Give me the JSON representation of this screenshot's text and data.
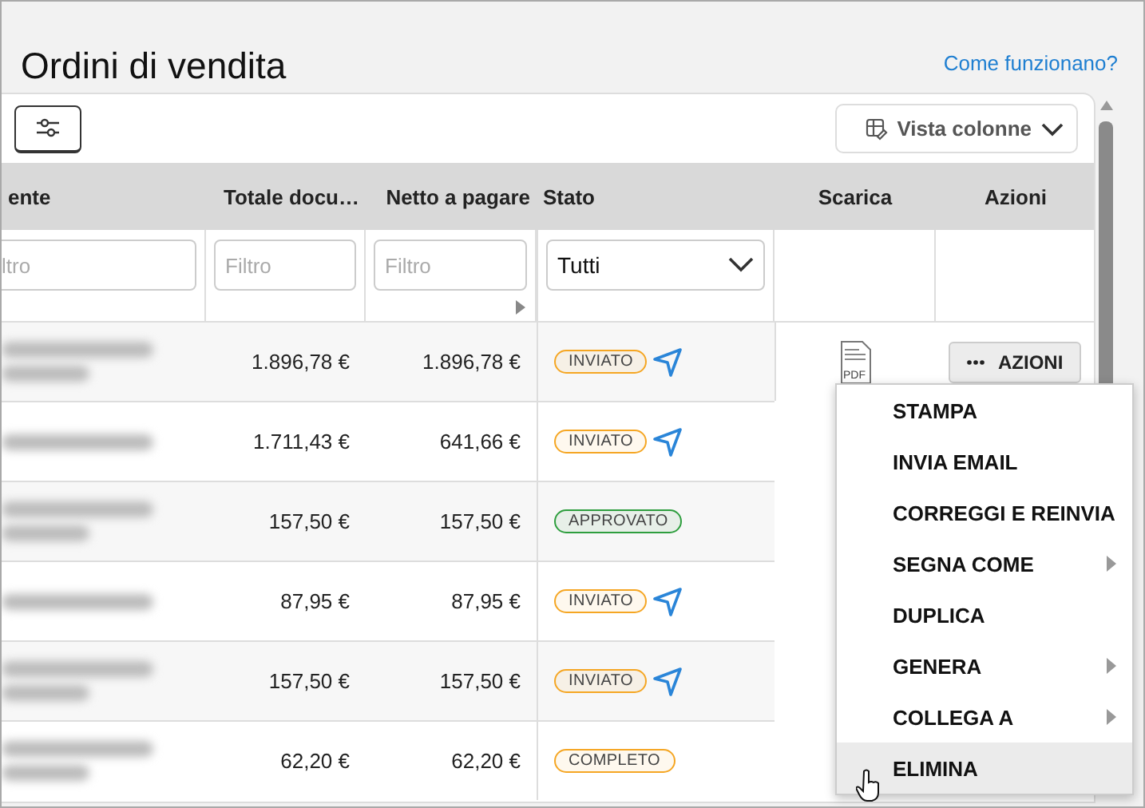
{
  "header": {
    "title": "Ordini di vendita",
    "help_link": "Come funzionano?"
  },
  "toolbar": {
    "columns_button": "Vista colonne"
  },
  "table": {
    "columns": [
      "ente",
      "Totale docu…",
      "Netto a pagare",
      "Stato",
      "Scarica",
      "Azioni"
    ],
    "filters": {
      "client": "ltro",
      "total": "Filtro",
      "net": "Filtro",
      "status": "Tutti"
    },
    "rows": [
      {
        "total": "1.896,78 €",
        "net": "1.896,78 €",
        "status": "INVIATO",
        "color": "#f5a623",
        "sent_icon": true,
        "pdf_label": "PDF",
        "actions": "AZIONI"
      },
      {
        "total": "1.711,43 €",
        "net": "641,66 €",
        "status": "INVIATO",
        "color": "#f5a623",
        "sent_icon": true
      },
      {
        "total": "157,50 €",
        "net": "157,50 €",
        "status": "APPROVATO",
        "color": "#2e9e3e",
        "sent_icon": false
      },
      {
        "total": "87,95 €",
        "net": "87,95 €",
        "status": "INVIATO",
        "color": "#f5a623",
        "sent_icon": true
      },
      {
        "total": "157,50 €",
        "net": "157,50 €",
        "status": "INVIATO",
        "color": "#f5a623",
        "sent_icon": true
      },
      {
        "total": "62,20 €",
        "net": "62,20 €",
        "status": "COMPLETO",
        "color": "#f5a623",
        "sent_icon": false
      }
    ]
  },
  "menu": {
    "items": [
      {
        "label": "STAMPA",
        "submenu": false,
        "hovered": false
      },
      {
        "label": "INVIA EMAIL",
        "submenu": false,
        "hovered": false
      },
      {
        "label": "CORREGGI E REINVIA",
        "submenu": false,
        "hovered": false
      },
      {
        "label": "SEGNA COME",
        "submenu": true,
        "hovered": false
      },
      {
        "label": "DUPLICA",
        "submenu": false,
        "hovered": false
      },
      {
        "label": "GENERA",
        "submenu": true,
        "hovered": false
      },
      {
        "label": "COLLEGA A",
        "submenu": true,
        "hovered": false
      },
      {
        "label": "ELIMINA",
        "submenu": false,
        "hovered": true
      }
    ]
  }
}
